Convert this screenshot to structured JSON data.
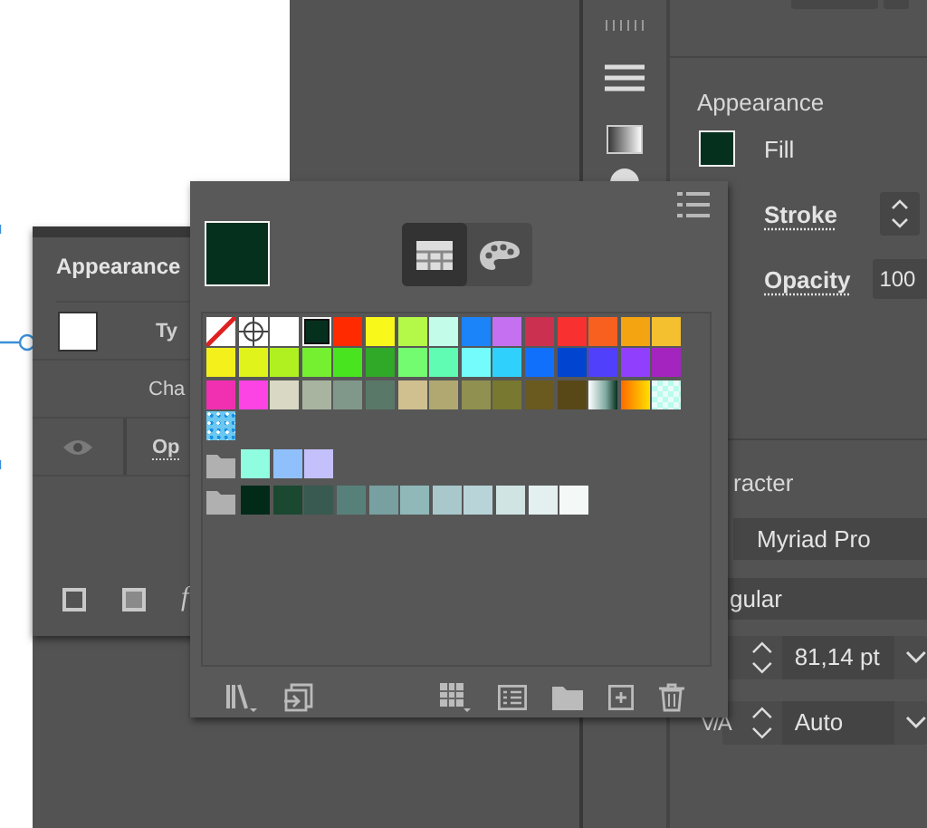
{
  "canvas_panel": {
    "title": "Appearance",
    "rows": [
      {
        "kind": "type",
        "label": "Ty"
      },
      {
        "kind": "sub",
        "label": "Cha"
      },
      {
        "kind": "opacity",
        "label": "Op"
      }
    ],
    "fx_label": "f"
  },
  "swatches_popup": {
    "views": [
      {
        "kind": "grid",
        "selected": true
      },
      {
        "kind": "palette",
        "selected": false
      }
    ],
    "rows": [
      {
        "kind": "colors",
        "swatches": [
          {
            "kind": "none",
            "selected": false
          },
          {
            "kind": "registration",
            "selected": false
          },
          {
            "kind": "color",
            "color": "#ffffff",
            "selected": false
          },
          {
            "kind": "color",
            "color": "#05301e",
            "selected": true
          },
          {
            "kind": "color",
            "color": "#ff2a00",
            "selected": false
          },
          {
            "kind": "color",
            "color": "#f8f81a",
            "selected": false
          },
          {
            "kind": "color",
            "color": "#b4f848",
            "selected": false
          },
          {
            "kind": "color",
            "color": "#c4fcea",
            "selected": false
          },
          {
            "kind": "color",
            "color": "#1a84f8",
            "selected": false
          },
          {
            "kind": "color",
            "color": "#c470f0",
            "selected": false
          },
          {
            "kind": "color",
            "color": "#cc3050",
            "selected": false
          },
          {
            "kind": "color",
            "color": "#f83030",
            "selected": false
          },
          {
            "kind": "color",
            "color": "#f86020",
            "selected": false
          },
          {
            "kind": "color",
            "color": "#f4a410",
            "selected": false
          },
          {
            "kind": "color",
            "color": "#f4c030",
            "selected": false
          }
        ]
      },
      {
        "kind": "colors",
        "swatches": [
          {
            "kind": "color",
            "color": "#f4f01c",
            "selected": false
          },
          {
            "kind": "color",
            "color": "#e0f41c",
            "selected": false
          },
          {
            "kind": "color",
            "color": "#b0f020",
            "selected": false
          },
          {
            "kind": "color",
            "color": "#74f030",
            "selected": false
          },
          {
            "kind": "color",
            "color": "#48e420",
            "selected": false
          },
          {
            "kind": "color",
            "color": "#30a828",
            "selected": false
          },
          {
            "kind": "color",
            "color": "#74fc70",
            "selected": false
          },
          {
            "kind": "color",
            "color": "#60fcb4",
            "selected": false
          },
          {
            "kind": "color",
            "color": "#74fcfc",
            "selected": false
          },
          {
            "kind": "color",
            "color": "#30d0fc",
            "selected": false
          },
          {
            "kind": "color",
            "color": "#1070fc",
            "selected": false
          },
          {
            "kind": "color",
            "color": "#0044d0",
            "selected": false
          },
          {
            "kind": "color",
            "color": "#5040fc",
            "selected": false
          },
          {
            "kind": "color",
            "color": "#9040fc",
            "selected": false
          },
          {
            "kind": "color",
            "color": "#a424c0",
            "selected": false
          }
        ]
      },
      {
        "kind": "colors",
        "swatches": [
          {
            "kind": "color",
            "color": "#f030b0",
            "selected": false
          },
          {
            "kind": "color",
            "color": "#fc44e4",
            "selected": false
          },
          {
            "kind": "color",
            "color": "#d8d8c4",
            "selected": false
          },
          {
            "kind": "color",
            "color": "#a8b4a0",
            "selected": false
          },
          {
            "kind": "color",
            "color": "#80988a",
            "selected": false
          },
          {
            "kind": "color",
            "color": "#5a7868",
            "selected": false
          },
          {
            "kind": "color",
            "color": "#d0c090",
            "selected": false
          },
          {
            "kind": "color",
            "color": "#b0a870",
            "selected": false
          },
          {
            "kind": "color",
            "color": "#909050",
            "selected": false
          },
          {
            "kind": "color",
            "color": "#787830",
            "selected": false
          },
          {
            "kind": "color",
            "color": "#6a5a20",
            "selected": false
          },
          {
            "kind": "color",
            "color": "#584818",
            "selected": false
          },
          {
            "kind": "fade",
            "selected": false
          },
          {
            "kind": "gradient",
            "selected": false
          },
          {
            "kind": "checker",
            "selected": false
          }
        ]
      },
      {
        "kind": "colors",
        "swatches": [
          {
            "kind": "pattern",
            "selected": false
          }
        ]
      },
      {
        "kind": "group",
        "swatches": [
          {
            "kind": "color",
            "color": "#90fce0",
            "selected": false
          },
          {
            "kind": "color",
            "color": "#90c0fc",
            "selected": false
          },
          {
            "kind": "color",
            "color": "#c4c0fc",
            "selected": false
          }
        ]
      },
      {
        "kind": "group",
        "swatches": [
          {
            "kind": "color",
            "color": "#022a18",
            "selected": false
          },
          {
            "kind": "color",
            "color": "#1a4830",
            "selected": false
          },
          {
            "kind": "color",
            "color": "#385a50",
            "selected": false
          },
          {
            "kind": "color",
            "color": "#58807a",
            "selected": false
          },
          {
            "kind": "color",
            "color": "#78a0a0",
            "selected": false
          },
          {
            "kind": "color",
            "color": "#90b8b8",
            "selected": false
          },
          {
            "kind": "color",
            "color": "#a8c8cc",
            "selected": false
          },
          {
            "kind": "color",
            "color": "#b8d4d8",
            "selected": false
          },
          {
            "kind": "color",
            "color": "#d0e4e4",
            "selected": false
          },
          {
            "kind": "color",
            "color": "#e4f0f0",
            "selected": false
          },
          {
            "kind": "color",
            "color": "#f4f8f6",
            "selected": false
          }
        ]
      }
    ]
  },
  "properties": {
    "appearance": {
      "title": "Appearance",
      "fill_label": "Fill",
      "stroke_label": "Stroke",
      "opacity_label": "Opacity",
      "opacity_value": "100"
    },
    "character": {
      "title": "racter",
      "font": "Myriad Pro",
      "style": "gular",
      "size": "81,14 pt",
      "kerning_label": "V/A",
      "kerning": "Auto"
    }
  }
}
